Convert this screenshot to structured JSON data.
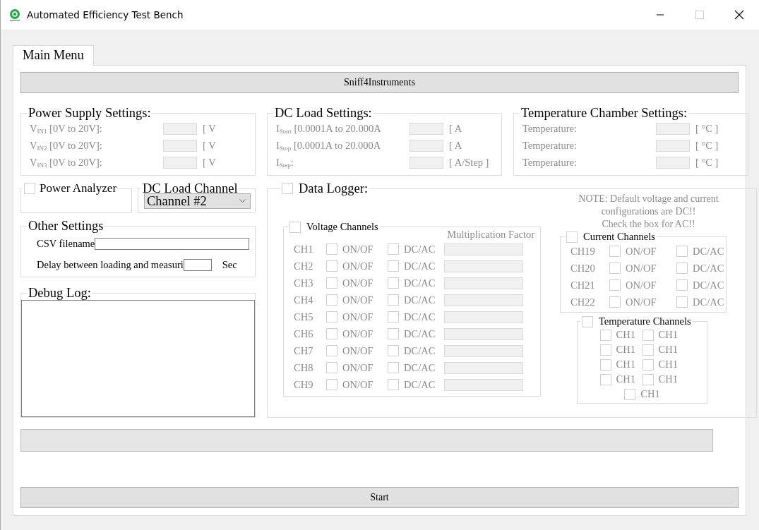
{
  "window": {
    "title": "Automated Efficiency Test Bench"
  },
  "tabs": [
    {
      "label": "Main Menu",
      "selected": true
    }
  ],
  "sniff_button": "Sniff4Instruments",
  "power_supply": {
    "title": "Power Supply Settings:",
    "disabled": true,
    "rows": [
      {
        "label": "V$_{IN1}$ [0V to 20V]:",
        "unit": "[ V"
      },
      {
        "label": "V$_{IN2}$ [0V to 20V]:",
        "unit": "[ V"
      },
      {
        "label": "V$_{IN3}$ [0V to 20V]:",
        "unit": "[ V"
      }
    ]
  },
  "dc_load": {
    "title": "DC Load Settings:",
    "disabled": true,
    "rows": [
      {
        "label": "I$_{Start}$ [0.0001A to 20.000A",
        "unit": "[ A"
      },
      {
        "label": "I$_{Stop}$ [0.0001A to 20.000A",
        "unit": "[ A"
      },
      {
        "label": "I$_{Step}$:",
        "unit": "[ A/Step ]"
      }
    ]
  },
  "temperature_chamber": {
    "title": "Temperature Chamber Settings:",
    "disabled": true,
    "rows": [
      {
        "label": "Temperature:",
        "unit": "[ °C ]"
      },
      {
        "label": "Temperature:",
        "unit": "[ °C ]"
      },
      {
        "label": "Temperature:",
        "unit": "[ °C ]"
      }
    ]
  },
  "power_analyzer": {
    "label": "Power Analyzer",
    "checked": false
  },
  "dc_load_channel": {
    "title": "DC Load Channel",
    "value": "Channel #2"
  },
  "other_settings": {
    "title": "Other Settings",
    "csv_label": "CSV filename",
    "delay_label": "Delay between loading and measuri",
    "delay_unit": "Sec"
  },
  "debug_log": {
    "title": "Debug Log:"
  },
  "data_logger": {
    "label": "Data Logger:",
    "checked": false,
    "disabled": true,
    "voltage": {
      "label": "Voltage Channels",
      "checked": false,
      "factor_heading": "Multiplication Factor",
      "channels": [
        {
          "name": "CH1",
          "on_label": "ON/OF",
          "on": false,
          "mode_label": "DC/AC",
          "ac": false
        },
        {
          "name": "CH2",
          "on_label": "ON/OF",
          "on": false,
          "mode_label": "DC/AC",
          "ac": false
        },
        {
          "name": "CH3",
          "on_label": "ON/OF",
          "on": false,
          "mode_label": "DC/AC",
          "ac": false
        },
        {
          "name": "CH4",
          "on_label": "ON/OF",
          "on": false,
          "mode_label": "DC/AC",
          "ac": false
        },
        {
          "name": "CH5",
          "on_label": "ON/OF",
          "on": false,
          "mode_label": "DC/AC",
          "ac": false
        },
        {
          "name": "CH6",
          "on_label": "ON/OF",
          "on": false,
          "mode_label": "DC/AC",
          "ac": false
        },
        {
          "name": "CH7",
          "on_label": "ON/OF",
          "on": false,
          "mode_label": "DC/AC",
          "ac": false
        },
        {
          "name": "CH8",
          "on_label": "ON/OF",
          "on": false,
          "mode_label": "DC/AC",
          "ac": false
        },
        {
          "name": "CH9",
          "on_label": "ON/OF",
          "on": false,
          "mode_label": "DC/AC",
          "ac": false
        }
      ]
    },
    "note": "NOTE: Default voltage and current\nconfigurations are DC!!\nCheck the box for AC!!",
    "current": {
      "label": "Current Channels",
      "checked": false,
      "channels": [
        {
          "name": "CH19",
          "on_label": "ON/OF",
          "on": false,
          "mode_label": "DC/AC",
          "ac": false
        },
        {
          "name": "CH20",
          "on_label": "ON/OF",
          "on": false,
          "mode_label": "DC/AC",
          "ac": false
        },
        {
          "name": "CH21",
          "on_label": "ON/OF",
          "on": false,
          "mode_label": "DC/AC",
          "ac": false
        },
        {
          "name": "CH22",
          "on_label": "ON/OF",
          "on": false,
          "mode_label": "DC/AC",
          "ac": false
        }
      ]
    },
    "temperature": {
      "label": "Temperature Channels",
      "checked": false,
      "channels": [
        {
          "name": "CH1",
          "checked": false
        },
        {
          "name": "CH1",
          "checked": false
        },
        {
          "name": "CH1",
          "checked": false
        },
        {
          "name": "CH1",
          "checked": false
        },
        {
          "name": "CH1",
          "checked": false
        },
        {
          "name": "CH1",
          "checked": false
        },
        {
          "name": "CH1",
          "checked": false
        },
        {
          "name": "CH1",
          "checked": false
        },
        {
          "name": "CH1",
          "checked": false
        }
      ]
    }
  },
  "start_button": "Start"
}
